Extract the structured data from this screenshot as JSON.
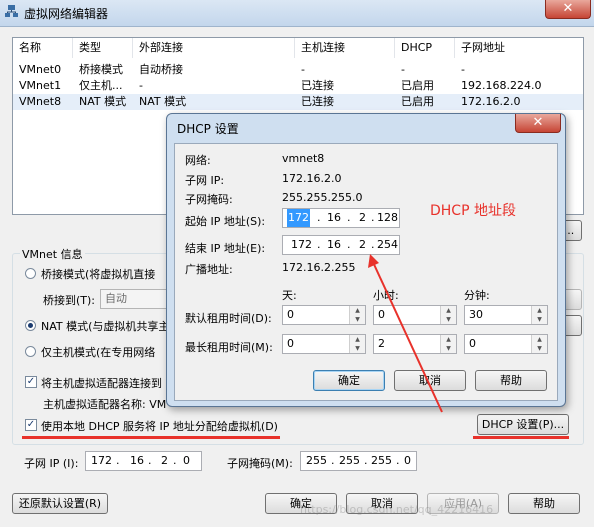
{
  "window": {
    "title": "虚拟网络编辑器",
    "close_glyph": "✕"
  },
  "table": {
    "headers": [
      "名称",
      "类型",
      "外部连接",
      "主机连接",
      "DHCP",
      "子网地址"
    ],
    "rows": [
      [
        "VMnet0",
        "桥接模式",
        "自动桥接",
        "-",
        "-",
        "-"
      ],
      [
        "VMnet1",
        "仅主机...",
        "-",
        "已连接",
        "已启用",
        "192.168.224.0"
      ],
      [
        "VMnet8",
        "NAT 模式",
        "NAT 模式",
        "已连接",
        "已启用",
        "172.16.2.0"
      ]
    ],
    "selected_row": 2
  },
  "vmnet_info": {
    "group_label": "VMnet 信息",
    "bridged_radio": "桥接模式(将虚拟机直接",
    "bridged_to_label": "桥接到(T):",
    "bridged_to_value": "自动",
    "nat_radio": "NAT 模式(与虚拟机共享主",
    "hostonly_radio": "仅主机模式(在专用网络",
    "connect_adapter_check": "将主机虚拟适配器连接到",
    "adapter_name_label": "主机虚拟适配器名称: VM",
    "dhcp_check": "使用本地 DHCP 服务将 IP 地址分配给虚拟机(D)",
    "dhcp_settings_button": "DHCP 设置(P)...",
    "subnet_ip_label": "子网 IP (I):",
    "subnet_ip": [
      "172",
      "16",
      "2",
      "0"
    ],
    "subnet_mask_label": "子网掩码(M):",
    "subnet_mask": [
      "255",
      "255",
      "255",
      "0"
    ]
  },
  "footer": {
    "restore_button": "还原默认设置(R)",
    "ok_button": "确定",
    "cancel_button": "取消",
    "apply_button": "应用(A)",
    "help_button": "帮助",
    "watermark": "https://blog.csdn.net/qq_42216416"
  },
  "dhcp_dialog": {
    "title": "DHCP 设置",
    "network_label": "网络:",
    "network_value": "vmnet8",
    "subnet_ip_label": "子网 IP:",
    "subnet_ip_value": "172.16.2.0",
    "subnet_mask_label": "子网掩码:",
    "subnet_mask_value": "255.255.255.0",
    "start_ip_label": "起始 IP 地址(S):",
    "start_ip": [
      "172",
      "16",
      "2",
      "128"
    ],
    "end_ip_label": "结束 IP 地址(E):",
    "end_ip": [
      "172",
      "16",
      "2",
      "254"
    ],
    "broadcast_label": "广播地址:",
    "broadcast_value": "172.16.2.255",
    "days_label": "天:",
    "hours_label": "小时:",
    "minutes_label": "分钟:",
    "default_lease_label": "默认租用时间(D):",
    "default_lease": [
      "0",
      "0",
      "30"
    ],
    "max_lease_label": "最长租用时间(M):",
    "max_lease": [
      "0",
      "2",
      "0"
    ],
    "ok_button": "确定",
    "cancel_button": "取消",
    "help_button": "帮助"
  },
  "annotation": {
    "text": "DHCP 地址段",
    "color": "#e8322b"
  }
}
